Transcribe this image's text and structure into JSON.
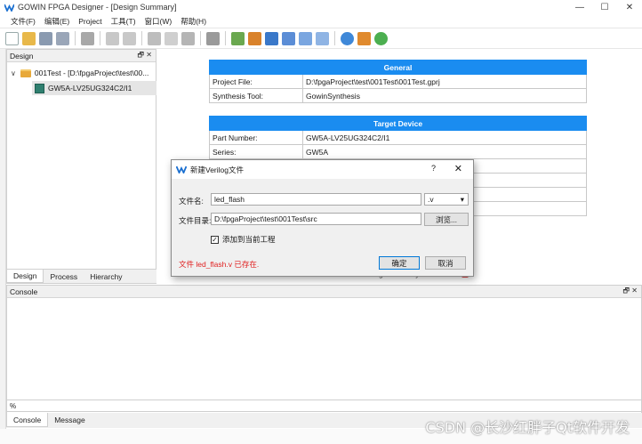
{
  "window": {
    "title": "GOWIN FPGA Designer - [Design Summary]",
    "controls": [
      "—",
      "☐",
      "✕"
    ]
  },
  "menu": [
    "文件(F)",
    "编辑(E)",
    "Project",
    "工具(T)",
    "窗口(W)",
    "帮助(H)"
  ],
  "design_panel": {
    "title": "Design",
    "tree": {
      "project": "001Test - [D:\\fpgaProject\\test\\00...",
      "device": "GW5A-LV25UG324C2/I1"
    },
    "tabs": [
      "Design",
      "Process",
      "Hierarchy"
    ]
  },
  "summary": {
    "general": {
      "header": "General",
      "rows": [
        {
          "key": "Project File:",
          "value": "D:\\fpgaProject\\test\\001Test\\001Test.gprj"
        },
        {
          "key": "Synthesis Tool:",
          "value": "GowinSynthesis"
        }
      ]
    },
    "target": {
      "header": "Target Device",
      "rows": [
        {
          "key": "Part Number:",
          "value": "GW5A-LV25UG324C2/I1"
        },
        {
          "key": "Series:",
          "value": "GW5A"
        },
        {
          "key": "",
          "value": ""
        },
        {
          "key": "",
          "value": ""
        },
        {
          "key": "",
          "value": ""
        },
        {
          "key": "",
          "value": ""
        },
        {
          "key": "",
          "value": ""
        }
      ]
    },
    "bottom_tab": "Design Summary"
  },
  "console": {
    "title": "Console",
    "input_value": "%",
    "tabs": [
      "Console",
      "Message"
    ]
  },
  "dialog": {
    "title": "新建Verilog文件",
    "help": "?",
    "close": "✕",
    "name_label": "文件名:",
    "name_value": "led_flash",
    "ext_value": ".v",
    "dir_label": "文件目录:",
    "dir_value": "D:\\fpgaProject\\test\\001Test\\src",
    "browse_label": "浏览...",
    "checkbox_label": "添加到当前工程",
    "checkbox_checked": "✓",
    "error_message": "文件 led_flash.v 已存在.",
    "ok_label": "确定",
    "cancel_label": "取消"
  },
  "watermark": "CSDN @长沙红胖子Qt软件开发",
  "colors": {
    "table_header": "#1a8cf0",
    "error": "#e02020",
    "selection": "#e5e5e5"
  }
}
